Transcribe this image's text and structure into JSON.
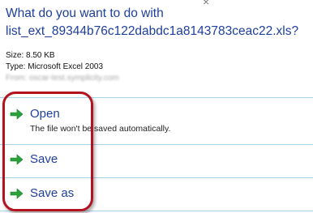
{
  "dialog": {
    "question_line1": "What do you want to do with",
    "question_line2": "list_ext_89344b76c122dabdc1a8143783ceac22.xls?",
    "close_glyph": "×"
  },
  "file_info": {
    "size": "Size: 8.50 KB",
    "type": "Type: Microsoft Excel 2003",
    "from": "From: oscar-test.symplicity.com"
  },
  "options": {
    "open": {
      "label": "Open",
      "description": "The file won't be saved automatically."
    },
    "save": {
      "label": "Save"
    },
    "save_as": {
      "label": "Save as"
    }
  },
  "colors": {
    "link_blue": "#1e3f9c",
    "arrow_green": "#2aa33a",
    "annotation_red": "#b3131e",
    "divider": "#a8d4ea"
  },
  "icons": {
    "option_arrow": "green-arrow-icon"
  }
}
